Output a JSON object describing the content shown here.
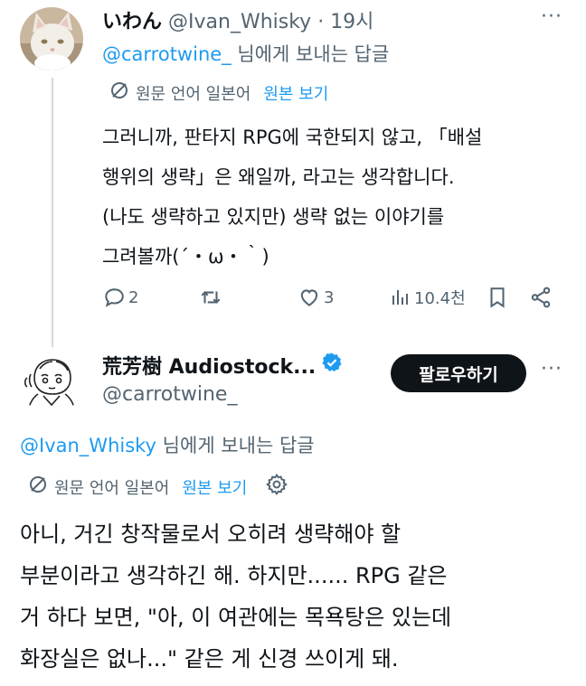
{
  "tweet1": {
    "display_name": "いわん",
    "handle": "@Ivan_Whisky",
    "time": "· 19시",
    "more": "···",
    "reply_to": "@carrotwine_",
    "reply_suffix": " 님에게 보내는 답글",
    "translate_source": "원문 언어 일본어",
    "translate_link": "원본 보기",
    "body_lines": [
      "그러니까, 판타지 RPG에 국한되지 않고, 「배설",
      "행위의 생략」은 왜일까, 라고는 생각합니다.",
      "(나도 생략하고 있지만) 생략 없는 이야기를",
      "그려볼까(´・ω・｀)"
    ],
    "replies": "2",
    "retweets": "",
    "likes": "3",
    "views": "10.4천"
  },
  "tweet2": {
    "display_name": "荒芳樹 Audiostock...",
    "handle": "@carrotwine_",
    "follow_label": "팔로우하기",
    "more": "···",
    "reply_to": "@Ivan_Whisky",
    "reply_suffix": " 님에게 보내는 답글",
    "translate_source": "원문 언어 일본어",
    "translate_link": "원본 보기",
    "body_lines": [
      "아니, 거긴 창작물로서 오히려 생략해야 할",
      "부분이라고 생각하긴 해. 하지만...... RPG 같은",
      "거 하다 보면, \"아, 이 여관에는 목욕탕은 있는데",
      "화장실은 없나...\" 같은 게 신경 쓰이게 돼."
    ]
  },
  "colors": {
    "accent": "#1d9bf0",
    "muted": "#536471",
    "text": "#0f1419",
    "verified": "#1d9bf0",
    "follow_bg": "#0f1419"
  }
}
